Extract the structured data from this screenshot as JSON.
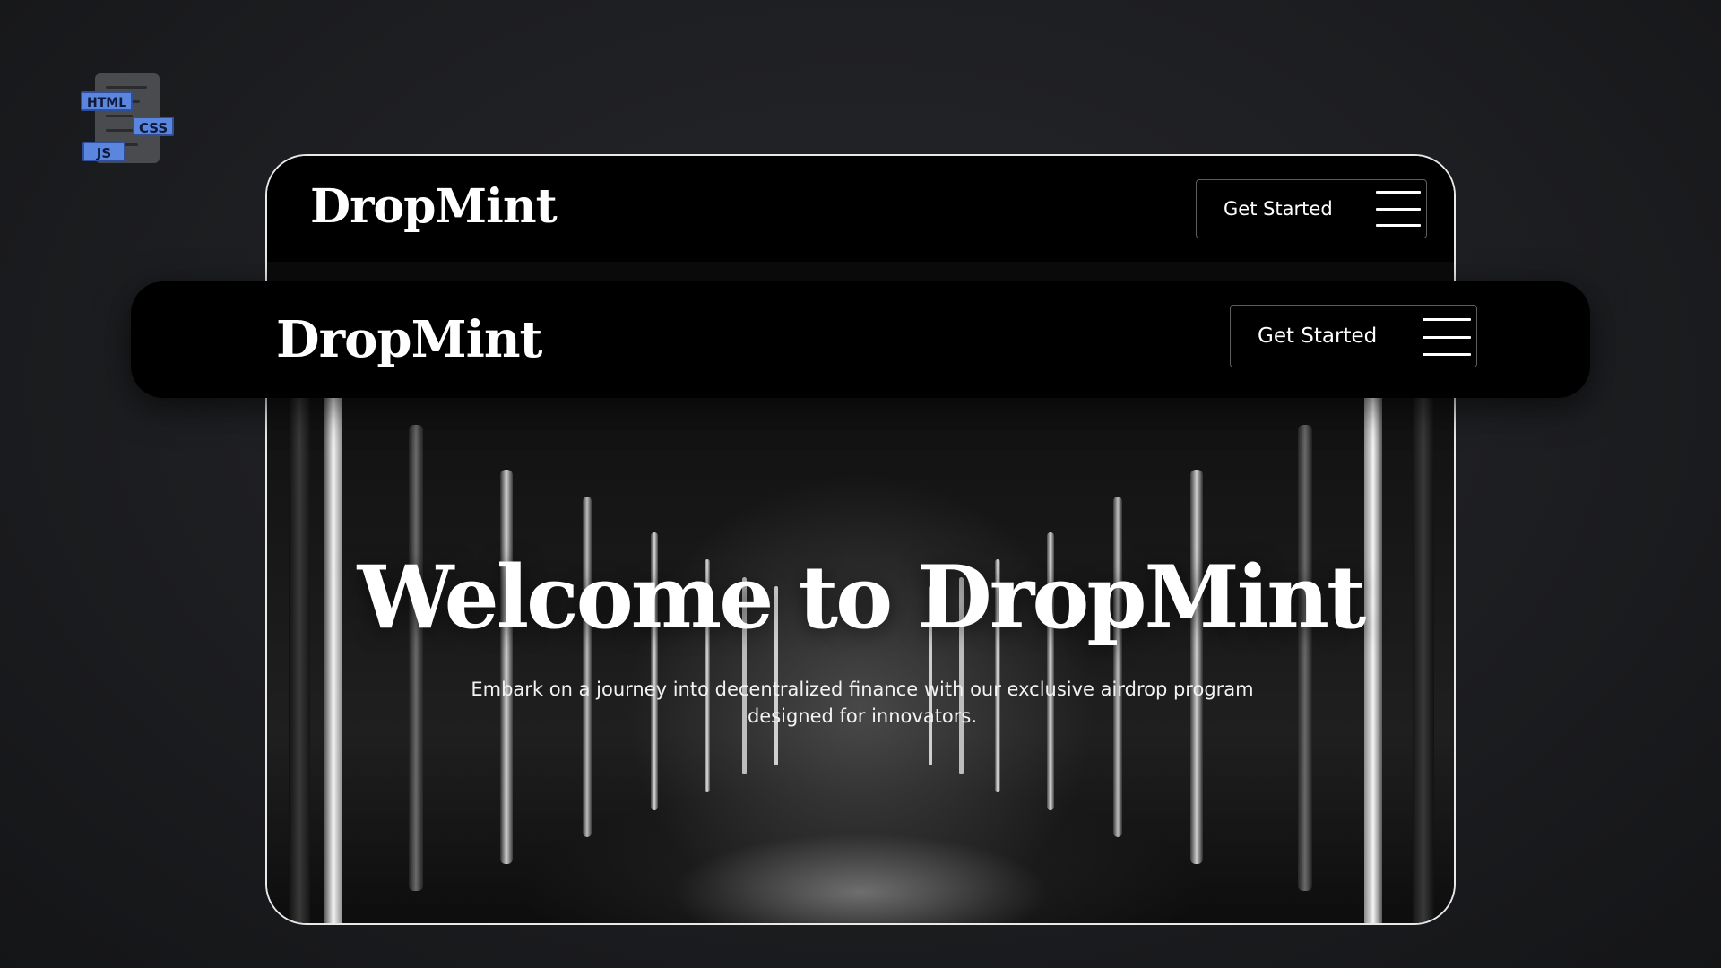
{
  "badge": {
    "html_label": "HTML",
    "css_label": "CSS",
    "js_label": "JS"
  },
  "hero_nav": {
    "logo": "DropMint",
    "cta_label": "Get Started"
  },
  "float_nav": {
    "logo": "DropMint",
    "cta_label": "Get Started"
  },
  "hero": {
    "title": "Welcome to DropMint",
    "subtitle": "Embark on a journey into decentralized finance with our exclusive airdrop program designed for innovators."
  },
  "colors": {
    "page_background": "#1b1c1f",
    "nav_background": "#000000",
    "text": "#ffffff",
    "card_border": "#e9e9e9",
    "badge_tag": "#5b86e0"
  },
  "icons": [
    "code-files-icon",
    "hamburger-menu-icon"
  ]
}
